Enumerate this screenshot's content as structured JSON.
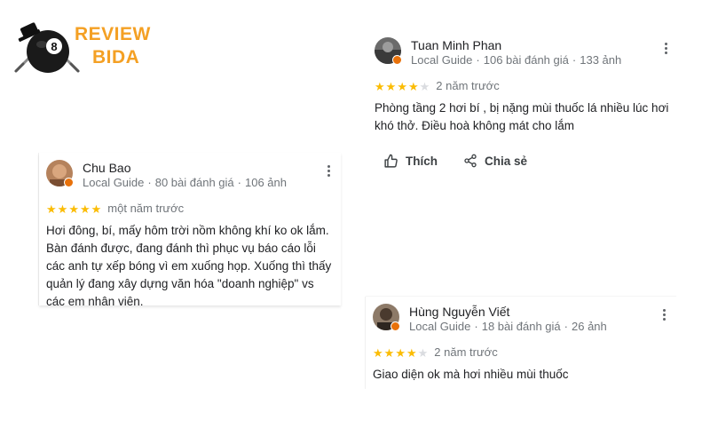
{
  "logo": {
    "line1": "REVIEW",
    "line2": "BIDA",
    "brand_color": "#f4a024"
  },
  "reviews": [
    {
      "name": "Tuan Minh Phan",
      "guide": "Local Guide",
      "reviews_count": "106 bài đánh giá",
      "photos_count": "133 ảnh",
      "rating": 4,
      "time": "2 năm trước",
      "text": "Phòng tầng 2 hơi bí , bị nặng mùi thuốc lá nhiều lúc hơi khó thở. Điều hoà không mát cho lắm",
      "actions": {
        "like": "Thích",
        "share": "Chia sẻ"
      }
    },
    {
      "name": "Chu Bao",
      "guide": "Local Guide",
      "reviews_count": "80 bài đánh giá",
      "photos_count": "106 ảnh",
      "rating": 5,
      "time": "một năm trước",
      "text": "Hơi đông, bí, mấy hôm trời nồm không khí ko ok lắm. Bàn đánh được, đang đánh thì phục vụ báo cáo lỗi các anh tự xếp bóng vì em xuống họp. Xuống thì thấy quản lý đang xây dựng văn hóa \"doanh nghiệp\" vs các em nhân viên."
    },
    {
      "name": "Hùng Nguyễn Viết",
      "guide": "Local Guide",
      "reviews_count": "18 bài đánh giá",
      "photos_count": "26 ảnh",
      "rating": 4,
      "time": "2 năm trước",
      "text": "Giao diện ok mà hơi nhiều mùi thuốc"
    }
  ],
  "colors": {
    "star": "#fbbc04",
    "star_empty": "#dadce0",
    "badge": "#e8710a",
    "meta": "#70757a"
  }
}
